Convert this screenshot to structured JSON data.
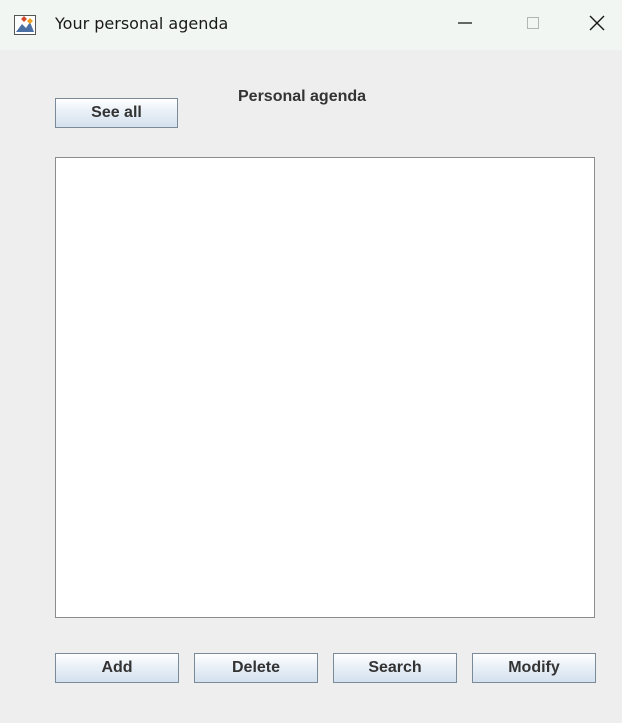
{
  "window": {
    "title": "Your personal agenda",
    "icon": "java-app-icon",
    "controls": {
      "minimize_icon": "minimize-icon",
      "maximize_icon": "maximize-icon",
      "close_icon": "close-icon"
    }
  },
  "main": {
    "heading": "Personal agenda",
    "see_all_label": "See all",
    "list_items": []
  },
  "actions": {
    "add_label": "Add",
    "delete_label": "Delete",
    "search_label": "Search",
    "modify_label": "Modify"
  },
  "colors": {
    "window_background": "#eeeeee",
    "titlebar_background": "#f1f6f2",
    "list_background": "#ffffff",
    "button_text": "#333333"
  }
}
